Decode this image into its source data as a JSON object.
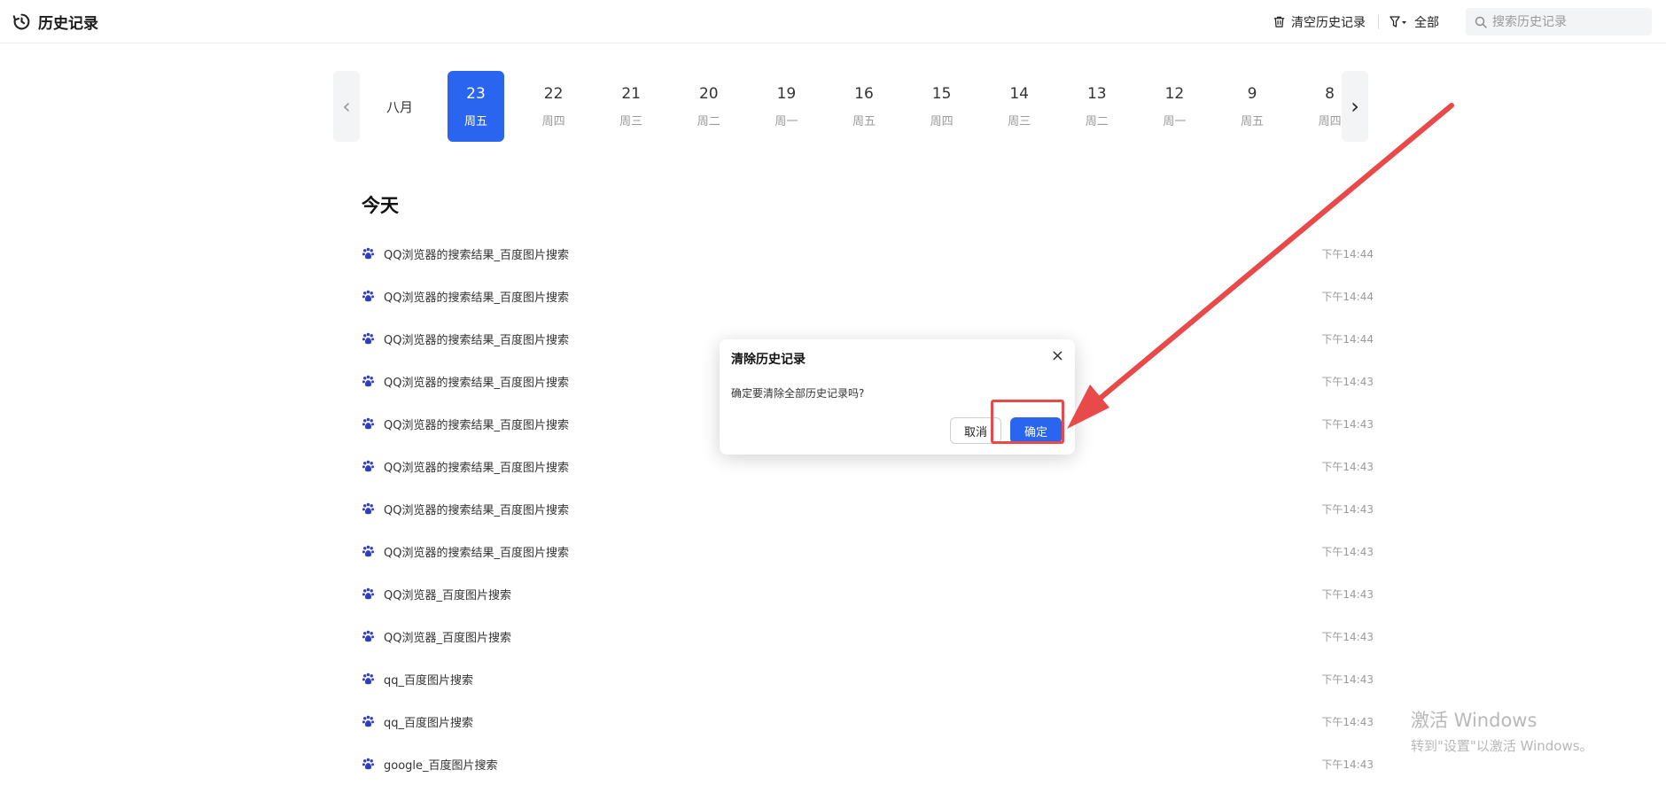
{
  "header": {
    "title": "历史记录",
    "clear_label": "清空历史记录",
    "filter_label": "全部",
    "search_placeholder": "搜索历史记录"
  },
  "datebar": {
    "month": "八月",
    "days": [
      {
        "num": "23",
        "wk": "周五",
        "active": true
      },
      {
        "num": "22",
        "wk": "周四"
      },
      {
        "num": "21",
        "wk": "周三"
      },
      {
        "num": "20",
        "wk": "周二"
      },
      {
        "num": "19",
        "wk": "周一"
      },
      {
        "num": "16",
        "wk": "周五"
      },
      {
        "num": "15",
        "wk": "周四"
      },
      {
        "num": "14",
        "wk": "周三"
      },
      {
        "num": "13",
        "wk": "周二"
      },
      {
        "num": "12",
        "wk": "周一"
      },
      {
        "num": "9",
        "wk": "周五"
      },
      {
        "num": "8",
        "wk": "周四"
      }
    ],
    "prev_icon": "‹",
    "next_icon": "›"
  },
  "section": {
    "title": "今天"
  },
  "history": [
    {
      "title": "QQ浏览器的搜索结果_百度图片搜索",
      "time": "下午14:44"
    },
    {
      "title": "QQ浏览器的搜索结果_百度图片搜索",
      "time": "下午14:44"
    },
    {
      "title": "QQ浏览器的搜索结果_百度图片搜索",
      "time": "下午14:44"
    },
    {
      "title": "QQ浏览器的搜索结果_百度图片搜索",
      "time": "下午14:43"
    },
    {
      "title": "QQ浏览器的搜索结果_百度图片搜索",
      "time": "下午14:43"
    },
    {
      "title": "QQ浏览器的搜索结果_百度图片搜索",
      "time": "下午14:43"
    },
    {
      "title": "QQ浏览器的搜索结果_百度图片搜索",
      "time": "下午14:43"
    },
    {
      "title": "QQ浏览器的搜索结果_百度图片搜索",
      "time": "下午14:43"
    },
    {
      "title": "QQ浏览器_百度图片搜索",
      "time": "下午14:43"
    },
    {
      "title": "QQ浏览器_百度图片搜索",
      "time": "下午14:43"
    },
    {
      "title": "qq_百度图片搜索",
      "time": "下午14:43"
    },
    {
      "title": "qq_百度图片搜索",
      "time": "下午14:43"
    },
    {
      "title": "google_百度图片搜索",
      "time": "下午14:43"
    }
  ],
  "dialog": {
    "title": "清除历史记录",
    "message": "确定要清除全部历史记录吗?",
    "cancel_label": "取消",
    "ok_label": "确定",
    "close_icon": "×"
  },
  "watermark": {
    "line1": "激活 Windows",
    "line2": "转到\"设置\"以激活 Windows。"
  },
  "colors": {
    "accent": "#2a65f0",
    "annotation": "#e84a4a",
    "paw_icon": "#2f3fbf"
  }
}
